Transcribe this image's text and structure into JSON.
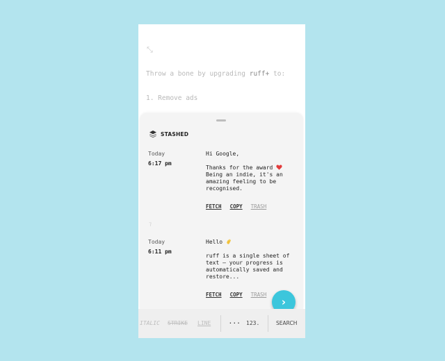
{
  "editor": {
    "glyph": "⤡",
    "line1_prefix": "Throw a bone by upgrading ",
    "line1_brand": "ruff+",
    "line1_suffix": " to:",
    "line2": "1. Remove ads"
  },
  "sheet": {
    "title": "STASHED",
    "title_icon": "layers-icon",
    "divider_glyph": "⁊"
  },
  "entries": [
    {
      "day": "Today",
      "time": "6:17 pm",
      "greeting": "Hi Google,",
      "greeting_emoji": "",
      "body_line": "Thanks for the award",
      "body_emoji": "heart-emoji",
      "body_rest": "Being an indie, it's an amazing feeling to be recognised.",
      "actions": {
        "fetch": "FETCH",
        "copy": "COPY",
        "trash": "TRASH"
      }
    },
    {
      "day": "Today",
      "time": "6:11 pm",
      "greeting": "Hello",
      "greeting_emoji": "wave-emoji",
      "body_line": "ruff is a single sheet of text — your progress is automatically saved and restore...",
      "actions": {
        "fetch": "FETCH",
        "copy": "COPY",
        "trash": "TRASH"
      }
    }
  ],
  "fab": {
    "icon": "chevron-right-icon",
    "glyph": "›"
  },
  "toolbar": {
    "italic": "ITALIC",
    "strike": "STRIKE",
    "line": "LINE",
    "more": "···",
    "numbered": "123.",
    "search": "SEARCH"
  },
  "colors": {
    "background": "#b3e4ee",
    "accent": "#3cc6dc",
    "sheet": "#f4f4f4"
  }
}
